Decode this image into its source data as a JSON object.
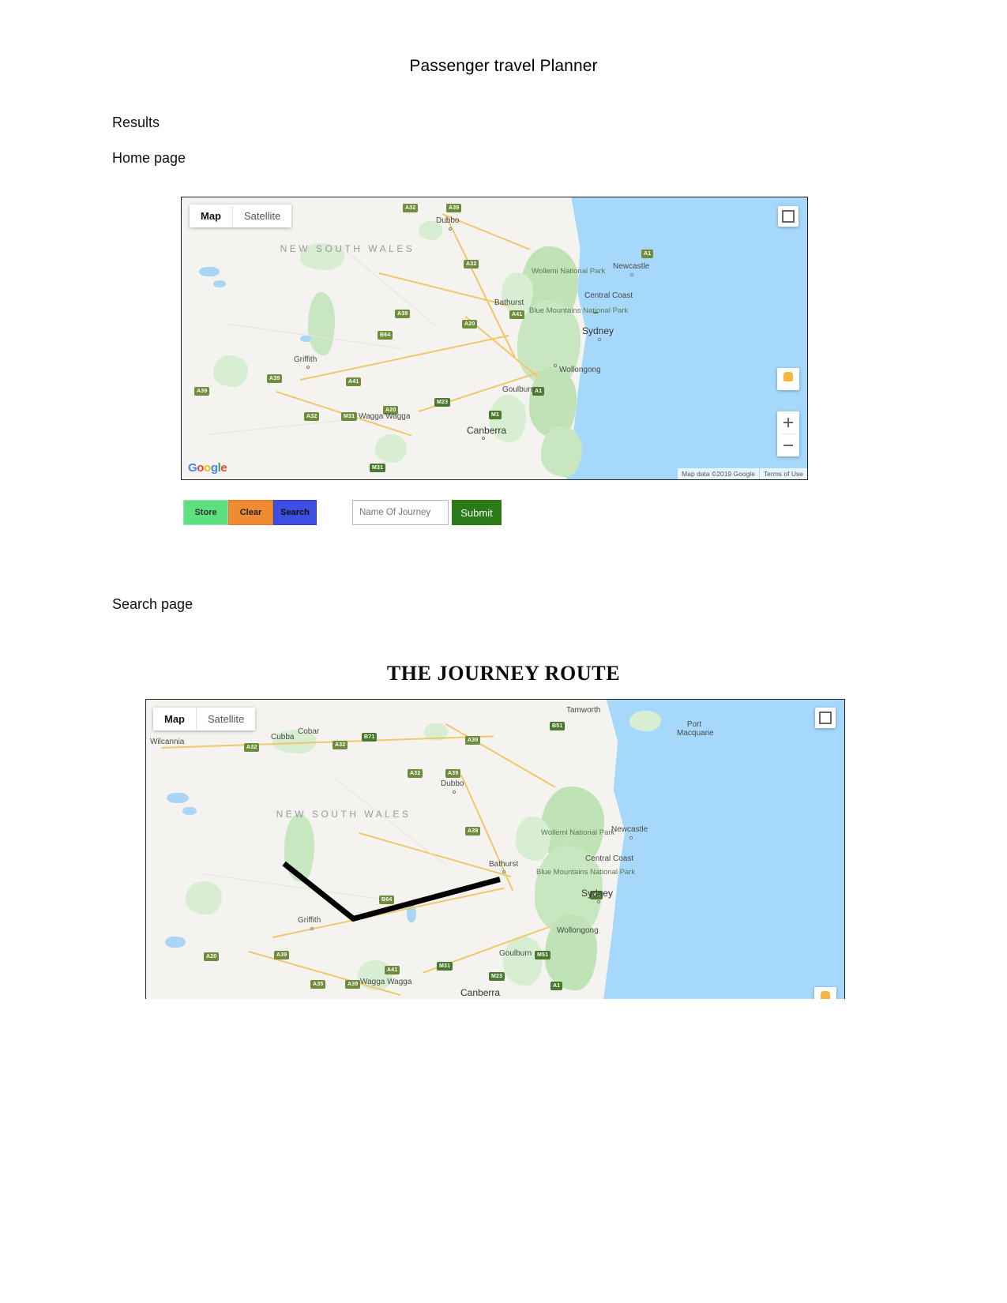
{
  "document": {
    "title": "Passenger travel Planner",
    "sections": [
      {
        "label": "Results"
      },
      {
        "label": "Home page"
      },
      {
        "label": "Search page"
      }
    ],
    "route_heading": "THE JOURNEY ROUTE"
  },
  "home_map": {
    "maptype": {
      "map": "Map",
      "satellite": "Satellite"
    },
    "attribution": {
      "data": "Map data ©2019 Google",
      "terms": "Terms of Use"
    },
    "logo": "Google",
    "icons": {
      "fullscreen": "fullscreen-icon",
      "pegman": "street-view-pegman-icon",
      "zoom_in": "zoom-in-icon",
      "zoom_out": "zoom-out-icon"
    },
    "labels": [
      {
        "text": "NEW SOUTH WALES",
        "type": "state"
      },
      {
        "text": "Dubbo",
        "type": "place"
      },
      {
        "text": "Newcastle",
        "type": "place"
      },
      {
        "text": "Central Coast",
        "type": "place"
      },
      {
        "text": "Sydney",
        "type": "city"
      },
      {
        "text": "Wollongong",
        "type": "place"
      },
      {
        "text": "Bathurst",
        "type": "place"
      },
      {
        "text": "Griffith",
        "type": "place"
      },
      {
        "text": "Goulburn",
        "type": "place"
      },
      {
        "text": "Canberra",
        "type": "city"
      },
      {
        "text": "Wagga Wagga",
        "type": "place"
      },
      {
        "text": "Wollemi National Park",
        "type": "park"
      },
      {
        "text": "Blue Mountains National Park",
        "type": "park"
      }
    ],
    "shields": [
      "A32",
      "A39",
      "A1",
      "A32",
      "A39",
      "A41",
      "B64",
      "A20",
      "A39",
      "A39",
      "A41",
      "A20",
      "A32",
      "M31",
      "M23",
      "A1",
      "M1",
      "M31"
    ]
  },
  "search_map": {
    "maptype": {
      "map": "Map",
      "satellite": "Satellite"
    },
    "icons": {
      "fullscreen": "fullscreen-icon",
      "pegman": "street-view-pegman-icon"
    },
    "labels": [
      {
        "text": "NEW SOUTH WALES",
        "type": "state"
      },
      {
        "text": "Wilcannia",
        "type": "place"
      },
      {
        "text": "Cubba",
        "type": "place"
      },
      {
        "text": "Cobar",
        "type": "place"
      },
      {
        "text": "Tamworth",
        "type": "place"
      },
      {
        "text": "Port Macquarie",
        "type": "place"
      },
      {
        "text": "Dubbo",
        "type": "place"
      },
      {
        "text": "Newcastle",
        "type": "place"
      },
      {
        "text": "Central Coast",
        "type": "place"
      },
      {
        "text": "Sydney",
        "type": "city"
      },
      {
        "text": "Bathurst",
        "type": "place"
      },
      {
        "text": "Wollongong",
        "type": "place"
      },
      {
        "text": "Griffith",
        "type": "place"
      },
      {
        "text": "Goulburn",
        "type": "place"
      },
      {
        "text": "Canberra",
        "type": "city"
      },
      {
        "text": "Wagga Wagga",
        "type": "place"
      },
      {
        "text": "Wollemi National Park",
        "type": "park"
      },
      {
        "text": "Blue Mountains National Park",
        "type": "park"
      }
    ],
    "shields": [
      "B71",
      "A32",
      "A32",
      "A39",
      "B51",
      "A32",
      "A39",
      "A39",
      "B64",
      "A20",
      "A39",
      "A41",
      "A35",
      "A39",
      "M31",
      "M23",
      "A1",
      "M1",
      "M51"
    ],
    "route_color": "#000000"
  },
  "controls": {
    "store": "Store",
    "clear": "Clear",
    "search": "Search",
    "submit": "Submit",
    "journey_placeholder": "Name Of Journey",
    "journey_value": ""
  },
  "colors": {
    "store": "#5ee07f",
    "clear": "#ef8b33",
    "search": "#3d4fe0",
    "submit": "#2a7a18",
    "sea": "#a6d8fb",
    "land": "#f4f3ef"
  }
}
